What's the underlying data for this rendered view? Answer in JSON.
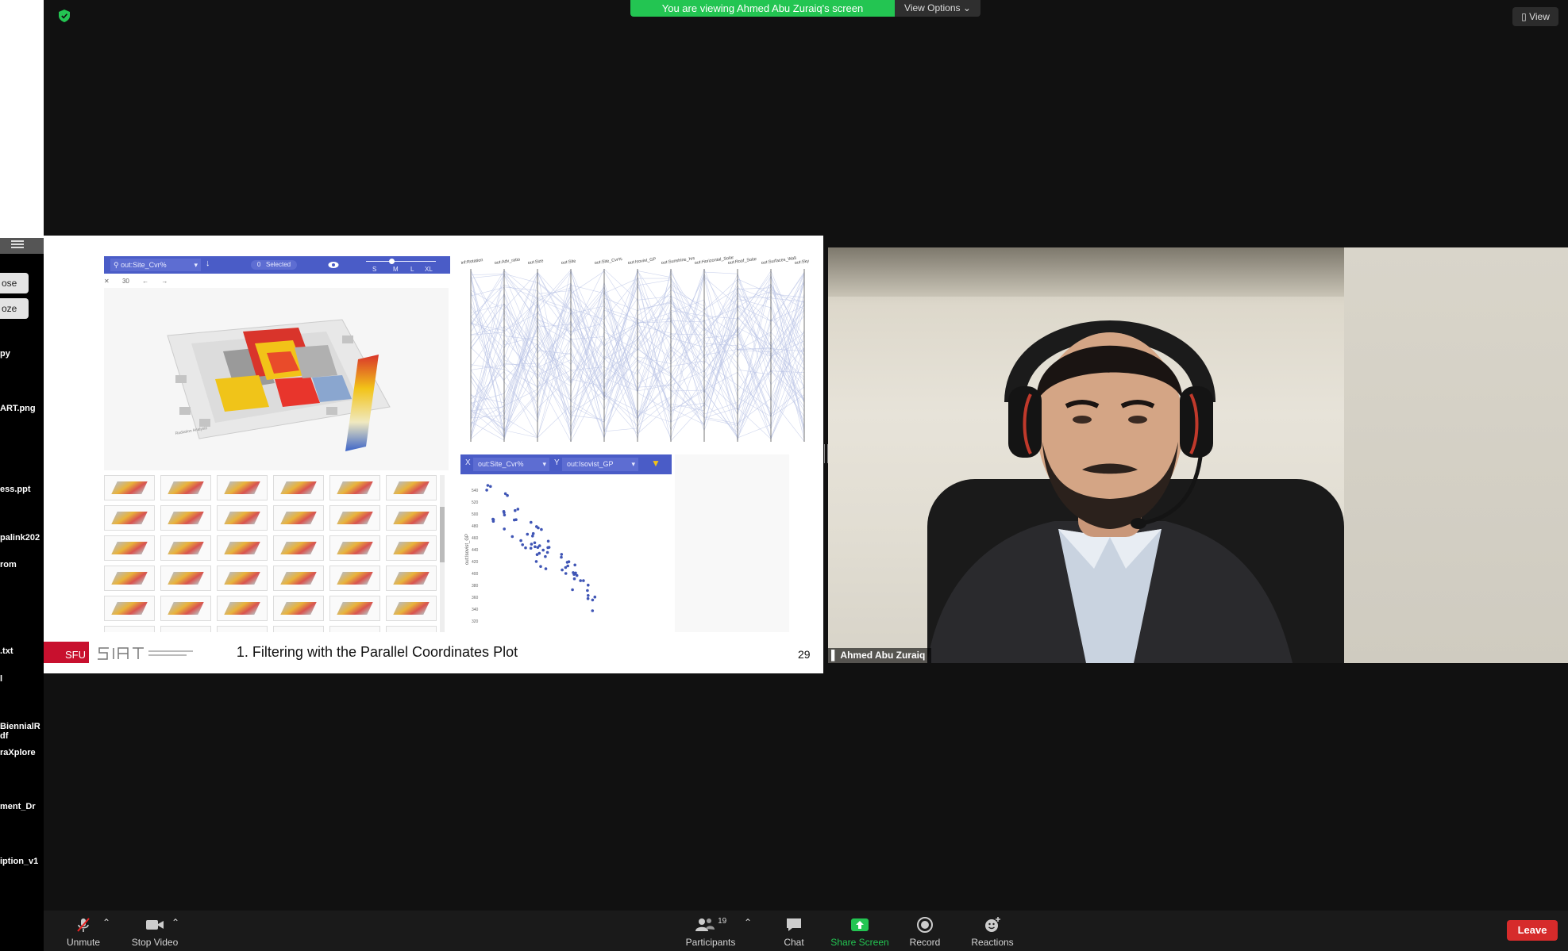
{
  "meeting": {
    "banner_text": "You are viewing Ahmed Abu Zuraiq's screen",
    "view_options_label": "View Options",
    "view_button_label": "View",
    "participant_name": "Ahmed Abu Zuraiq",
    "accent_green": "#23c552",
    "leave_red": "#d62b2b"
  },
  "desktop": {
    "buttons": [
      "ose",
      "oze"
    ],
    "files": [
      "py",
      "ART.png",
      "ess.ppt",
      "palink202",
      "rom",
      ".txt",
      "l",
      "BiennialR\ndf",
      "raXplore",
      "ment_Dr",
      "iption_v1"
    ]
  },
  "slide": {
    "search_value": "out:Site_Cvr%",
    "selected_count": "0",
    "selected_label": "Selected",
    "size_options": [
      "S",
      "M",
      "L",
      "XL"
    ],
    "sub_toolbar_count": "30",
    "axes_labels": [
      "inf:Rotation",
      "out:Adv_ratio",
      "out:Size",
      "out:Site",
      "out:Site_Cvr%",
      "out:Isovist_GP",
      "out:Sunshine_hrs",
      "out:Horizontal_Solar",
      "out:Roof_Solar",
      "out:Surfaces_Wall",
      "out:Sky"
    ],
    "scatter_x_select": "out:Site_Cvr%",
    "scatter_y_select": "out:Isovist_GP",
    "scatter_y_label": "out:Isovist_GP",
    "scatter_y_ticks": [
      "540",
      "520",
      "500",
      "480",
      "460",
      "440",
      "420",
      "400",
      "380",
      "360",
      "340",
      "320"
    ],
    "footer_logo_text": "SFU",
    "title": "1. Filtering with the Parallel Coordinates Plot",
    "page_number": "29"
  },
  "controls": {
    "unmute": "Unmute",
    "stop_video": "Stop Video",
    "participants": "Participants",
    "participant_count": "19",
    "chat": "Chat",
    "share_screen": "Share Screen",
    "record": "Record",
    "reactions": "Reactions",
    "leave": "Leave"
  }
}
